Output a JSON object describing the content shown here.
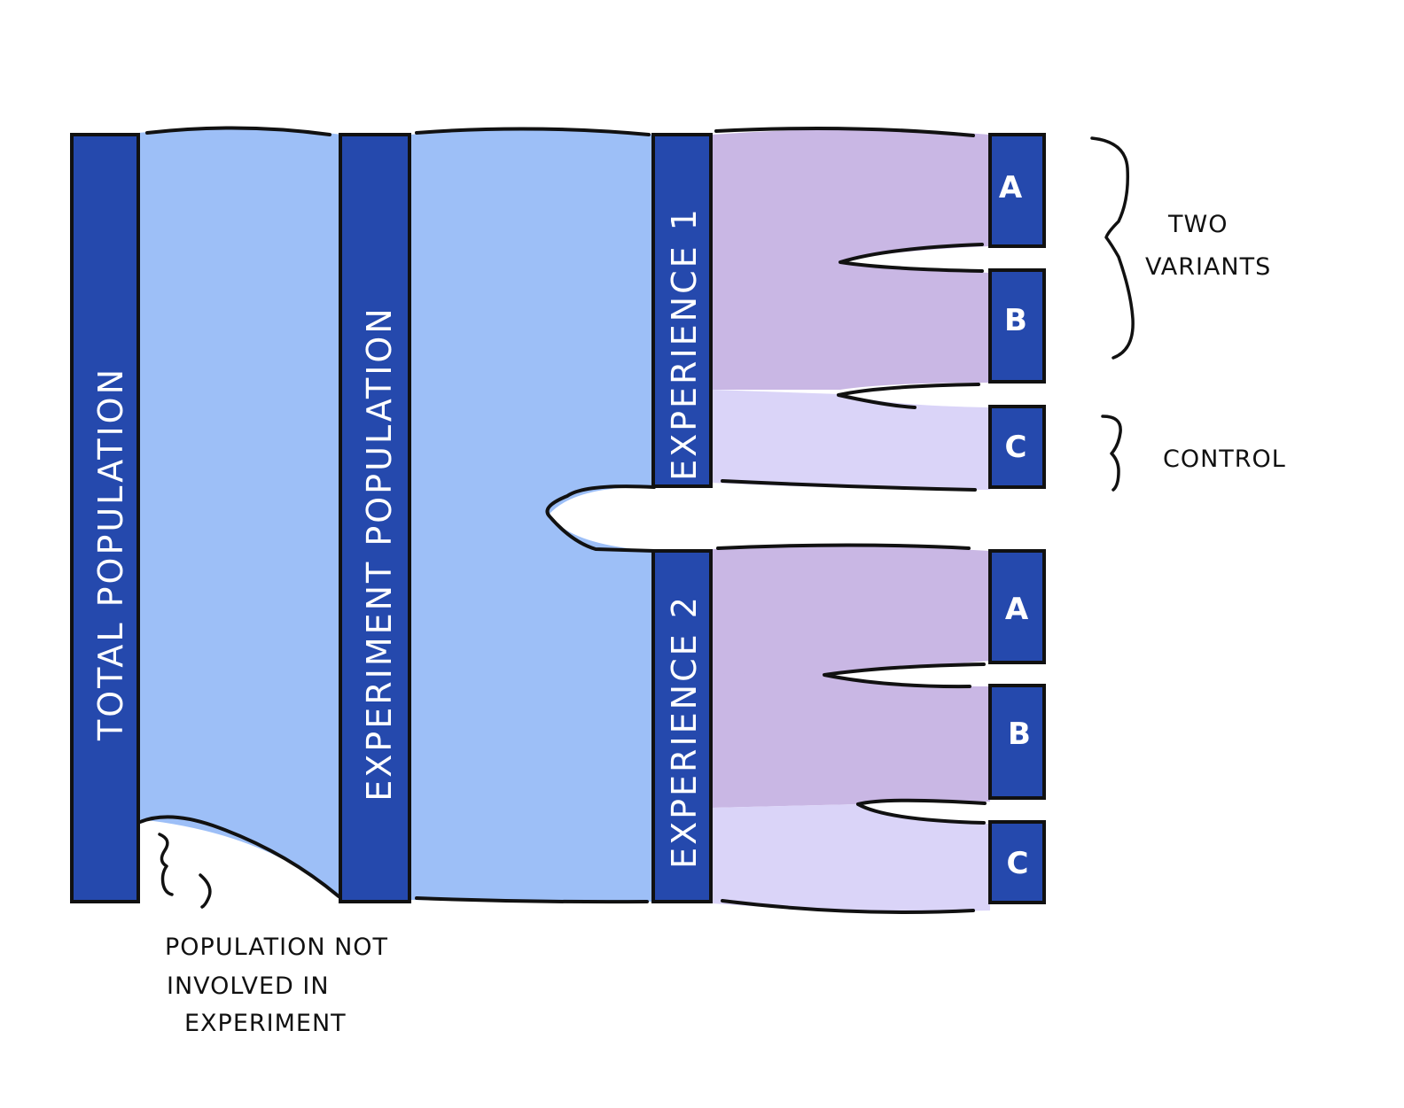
{
  "nodes": {
    "total": "TOTAL POPULATION",
    "experiment": "EXPERIMENT POPULATION",
    "experience1": "EXPERIENCE 1",
    "experience2": "EXPERIENCE 2",
    "exp1_a": "A",
    "exp1_b": "B",
    "exp1_c": "C",
    "exp2_a": "A",
    "exp2_b": "B",
    "exp2_c": "C"
  },
  "annotations": {
    "two_variants_line1": "TWO",
    "two_variants_line2": "VARIANTS",
    "control": "CONTROL",
    "not_involved_line1": "POPULATION NOT",
    "not_involved_line2": "INVOLVED IN",
    "not_involved_line3": "EXPERIMENT"
  },
  "colors": {
    "node": "#2549AD",
    "population_flow": "#9DBFF7",
    "variant_flow": "#C9B7E4",
    "control_flow": "#DAD4F8",
    "outline": "#111111"
  }
}
